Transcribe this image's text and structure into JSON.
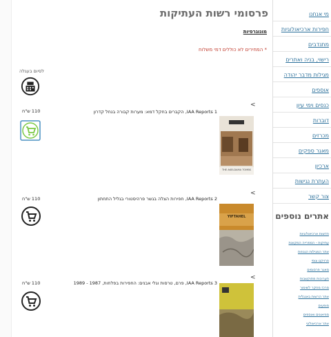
{
  "page": {
    "title": "פרסומי רשות העתיקות",
    "subtitle": "מונוגרפיות",
    "note": "* המחירים לא כוללים דמי משלוח",
    "cart_label": "לסיום בעגלה"
  },
  "items": [
    {
      "arrow": "<",
      "text": "IAA Reports 1, הקברים בחקל דמא: מערות קבורה בנחל קדרון",
      "price": "110 ש\"ח",
      "cover_title": "THE AKELDAMA TOMBS"
    },
    {
      "arrow": "<",
      "text": "IAA Reports 2, חפירות הצלה בגשר פרהיסטורי בגליל התחתון",
      "price": "110 ש\"ח",
      "cover_title": "YIFTAHEL"
    },
    {
      "arrow": "<",
      "text": "IAA Reports 3, פרם, טרסות וגלי אבנים: החפירות בפלחות, 1987 - 1989",
      "price": "110 ש\"ח",
      "cover_title": ""
    }
  ],
  "sidebar": {
    "nav": [
      "מי אנחנו",
      "חפירות ארכיאולוגיות",
      "מתנדבים",
      "רישוי, בניה ואתרים",
      "מגילות מדבר יהודה",
      "אוספים",
      "כנסים וימי עיון",
      "דוברות",
      "מכרזים",
      "מאגר ספקים",
      "ארכיון",
      "העתרת נגישות",
      "צור קשר"
    ],
    "more_title": "אתרים נוספים",
    "sites": [
      "חדשות ארכיאולוגיות",
      "עתיקות - הספרייה המקוונת",
      "אתר המגילות הגנוזות",
      "פרויקט צופי",
      "מאגר פרסומים",
      "תערוכות מתוקשבות",
      "מרכז מחקר לשימור",
      "אתר הרשות באנגלית",
      "מופעים",
      "מוזיאונים ואוספים",
      "אתר ארכיאולוגי"
    ]
  },
  "colors": {
    "link": "#2a6f9a",
    "note": "#c0392b",
    "cart_green": "#7ac943"
  }
}
